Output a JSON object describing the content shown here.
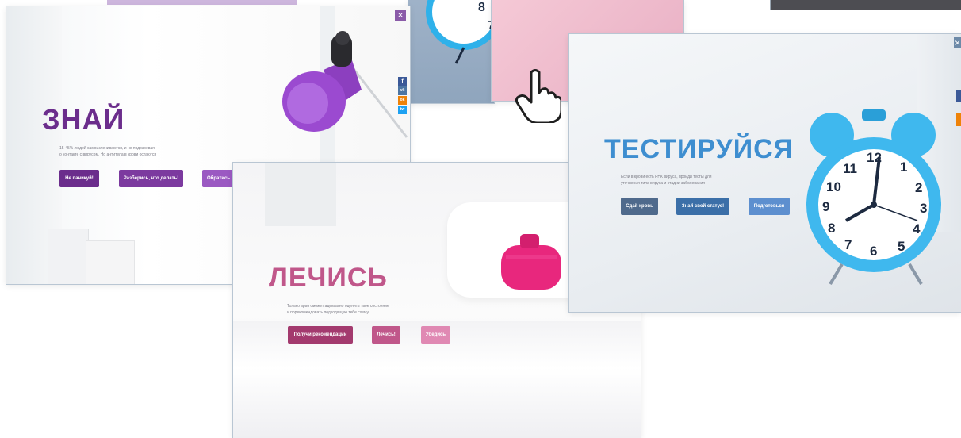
{
  "cards": {
    "znai": {
      "headline": "ЗНАЙ",
      "subtitle_line1": "15-45% людей самоизлечиваются, и не подозревая",
      "subtitle_line2": "о контакте с вирусом. Но антитела в крови остаются",
      "buttons": [
        "Не паникуй!",
        "Разберись, что делать!",
        "Обратись к"
      ],
      "close_label": "×",
      "share": [
        "f",
        "vk",
        "ok",
        "tw"
      ],
      "accent": "#6b2d8c"
    },
    "lech": {
      "headline": "ЛЕЧИСЬ",
      "subtitle_line1": "Только врач сможет адекватно оценить твое состояние",
      "subtitle_line2": "и порекомендовать подходящую тебе схему",
      "buttons": [
        "Получи рекомендации",
        "Лечись!",
        "Убедись"
      ],
      "accent": "#c03f80"
    },
    "test": {
      "headline": "ТЕСТИРУЙСЯ",
      "subtitle_line1": "Если в крови есть РНК вируса, пройди тесты для",
      "subtitle_line2": "уточнения типа вируса и стадии заболевания",
      "buttons": [
        "Сдай кровь",
        "Знай свой статус!",
        "Подготовься"
      ],
      "close_label": "×",
      "accent": "#3e8ed0"
    }
  },
  "colors": {
    "purple": "#6b2d8c",
    "purple_light": "#9b59c2",
    "pink": "#b5447e",
    "pink_light": "#e07fae",
    "blue": "#3e8ed0",
    "slate": "#4f6a8c"
  },
  "icons": [
    "lamp-icon",
    "alarm-clock-icon",
    "hot-water-bottle-icon",
    "pointer-hand-icon",
    "close-icon"
  ]
}
